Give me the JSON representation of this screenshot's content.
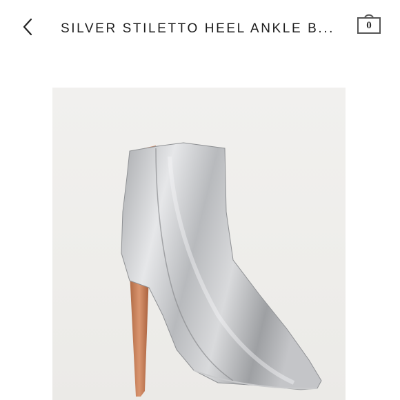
{
  "header": {
    "back_icon": "chevron-left-icon",
    "title": "SILVER STILETTO HEEL ANKLE B...",
    "cart_icon": "shopping-bag-icon",
    "cart_count": "0"
  },
  "product": {
    "image_description": "silver stiletto heel ankle boot photo",
    "background_color": "#efeeeb",
    "boot_color": "#c9cacc",
    "heel_color": "#c8825e"
  }
}
